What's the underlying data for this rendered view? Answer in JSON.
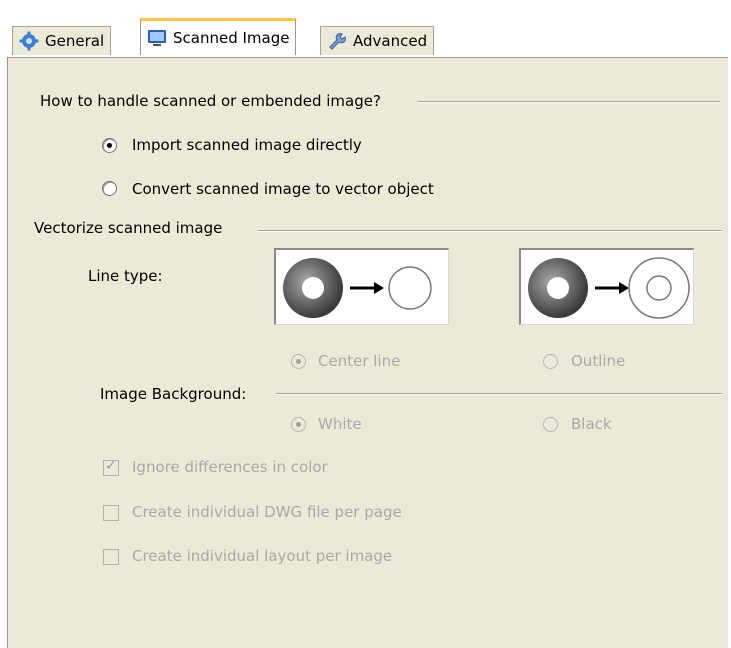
{
  "tabs": [
    {
      "label": "General",
      "icon": "gear-icon",
      "active": false
    },
    {
      "label": "Scanned Image",
      "icon": "monitor-icon",
      "active": true
    },
    {
      "label": "Advanced",
      "icon": "wrench-icon",
      "active": false
    }
  ],
  "group_scanned": {
    "title": "How to handle scanned or embended image?",
    "options": [
      {
        "label": "Import scanned image directly",
        "checked": true
      },
      {
        "label": "Convert scanned image to vector object",
        "checked": false
      }
    ]
  },
  "group_vectorize": {
    "title": "Vectorize scanned image",
    "line_type_label": "Line type:",
    "line_type_options": [
      {
        "label": "Center line",
        "checked": true
      },
      {
        "label": "Outline",
        "checked": false
      }
    ],
    "background_label": "Image Background:",
    "background_options": [
      {
        "label": "White",
        "checked": true
      },
      {
        "label": "Black",
        "checked": false
      }
    ]
  },
  "checkboxes": [
    {
      "label": "Ignore differences in color",
      "checked": true
    },
    {
      "label": "Create individual DWG file per page",
      "checked": false
    },
    {
      "label": "Create  individual layout per image",
      "checked": false
    }
  ],
  "colors": {
    "panel_bg": "#ece9d8",
    "tab_highlight": "#ffc83c",
    "disabled_text": "#a8a8a8"
  }
}
